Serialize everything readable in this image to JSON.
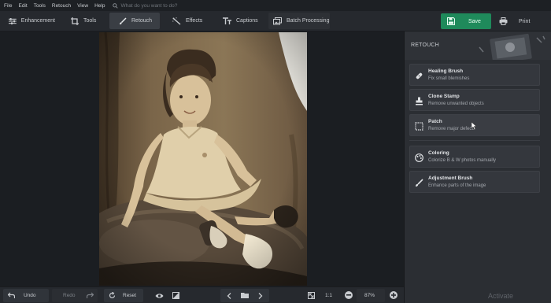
{
  "menu": [
    "File",
    "Edit",
    "Tools",
    "Retouch",
    "View",
    "Help"
  ],
  "search": {
    "placeholder": "What do you want to do?"
  },
  "toolbar": {
    "tabs": [
      {
        "label": "Enhancement",
        "icon": "sliders-icon"
      },
      {
        "label": "Tools",
        "icon": "crop-icon"
      },
      {
        "label": "Retouch",
        "icon": "brush-icon",
        "active": true
      },
      {
        "label": "Effects",
        "icon": "magic-wand-icon"
      },
      {
        "label": "Captions",
        "icon": "text-icon"
      },
      {
        "label": "Batch Processing",
        "icon": "images-icon"
      }
    ],
    "save_label": "Save",
    "print_label": "Print",
    "accent": "#1f8a5b"
  },
  "panel": {
    "title": "RETOUCH",
    "tools": [
      {
        "title": "Healing Brush",
        "desc": "Fix small blemishes",
        "icon": "bandage-icon"
      },
      {
        "title": "Clone Stamp",
        "desc": "Remove unwanted objects",
        "icon": "stamp-icon"
      },
      {
        "title": "Patch",
        "desc": "Remove major defects",
        "icon": "patch-icon"
      },
      {
        "title": "Coloring",
        "desc": "Colorize B & W photos manually",
        "icon": "palette-icon"
      },
      {
        "title": "Adjustment Brush",
        "desc": "Enhance parts of the image",
        "icon": "brush-icon"
      }
    ]
  },
  "bottom": {
    "undo": "Undo",
    "redo": "Redo",
    "reset": "Reset",
    "ratio": "1:1",
    "zoom": "87%"
  },
  "watermark": "Activate"
}
